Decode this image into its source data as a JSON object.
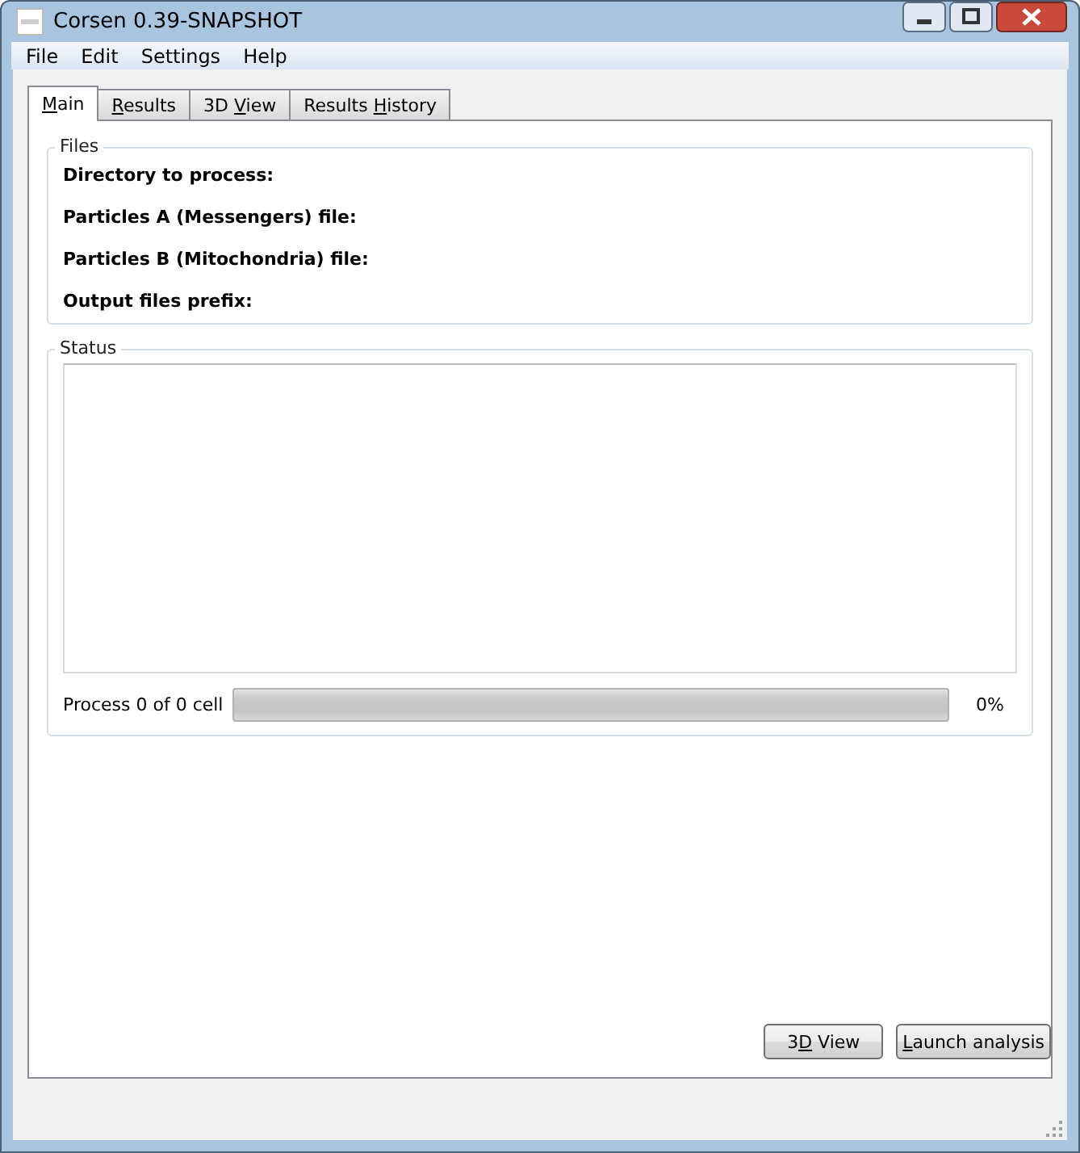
{
  "window": {
    "title": "Corsen 0.39-SNAPSHOT"
  },
  "menu": [
    "File",
    "Edit",
    "Settings",
    "Help"
  ],
  "tabs": [
    {
      "label_parts": [
        {
          "text": "M",
          "underlined": true
        },
        {
          "text": "ain",
          "underlined": false
        }
      ],
      "selected": true
    },
    {
      "label_parts": [
        {
          "text": "R",
          "underlined": true
        },
        {
          "text": "esults",
          "underlined": false
        }
      ],
      "selected": false
    },
    {
      "label_parts": [
        {
          "text": "3D ",
          "underlined": false
        },
        {
          "text": "V",
          "underlined": true
        },
        {
          "text": "iew",
          "underlined": false
        }
      ],
      "selected": false
    },
    {
      "label_parts": [
        {
          "text": "Results ",
          "underlined": false
        },
        {
          "text": "H",
          "underlined": true
        },
        {
          "text": "istory",
          "underlined": false
        }
      ],
      "selected": false
    }
  ],
  "files": {
    "title": "Files",
    "fields": [
      "Directory to process:",
      "Particles A (Messengers) file:",
      "Particles B (Mitochondria) file:",
      "Output files prefix:"
    ]
  },
  "status": {
    "title": "Status",
    "progress_label": "Process 0 of 0 cell",
    "progress": {
      "level": 0
    },
    "percent": "0%"
  },
  "buttons": [
    {
      "label_parts": [
        {
          "text": "3",
          "underlined": false
        },
        {
          "text": "D",
          "underlined": true
        },
        {
          "text": " View",
          "underlined": false
        }
      ]
    },
    {
      "label_parts": [
        {
          "text": "L",
          "underlined": true
        },
        {
          "text": "aunch analysis",
          "underlined": false
        }
      ]
    }
  ]
}
